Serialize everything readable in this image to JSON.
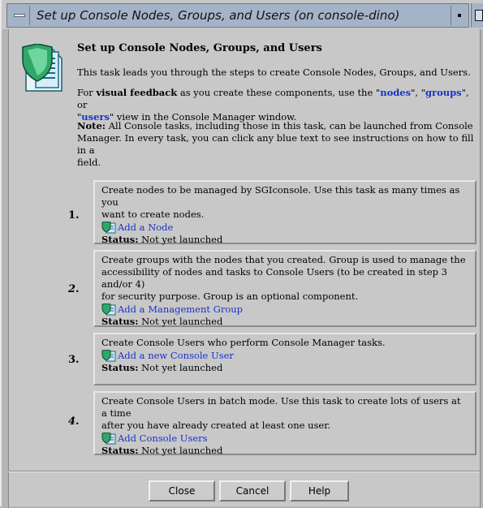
{
  "window": {
    "title": "Set up Console Nodes, Groups, and Users (on console-dino)"
  },
  "intro": {
    "heading": "Set up Console Nodes, Groups, and Users",
    "description": "This task leads you through the steps to create Console Nodes, Groups, and Users.",
    "feedback_prefix": "For ",
    "feedback_bold": "visual feedback",
    "feedback_mid": " as you create these components, use the \"",
    "link_nodes": "nodes",
    "sep1": "\", \"",
    "link_groups": "groups",
    "sep2": "\", or",
    "link_users": "users",
    "feedback_suffix": "\" view in the Console Manager window.",
    "note_bold": "Note:",
    "note_line1": " All Console tasks, including those in this task, can be launched from Console",
    "note_line2": "Manager.  In every task, you can click any blue text to see instructions on how to fill in a",
    "note_line3": "field."
  },
  "steps": [
    {
      "number": "1.",
      "line1": "Create nodes to be managed by SGIconsole.  Use this task as many times as you",
      "line2": "want to create nodes.",
      "line3": "",
      "link": "Add a Node",
      "status_label": "Status:",
      "status_value": " Not yet launched"
    },
    {
      "number": "2.",
      "line1": "Create groups with the nodes that you created.  Group is used to manage the",
      "line2": "accessibility of nodes and tasks to Console Users (to be created in step 3 and/or 4)",
      "line3": "for security purpose.  Group is an optional component.",
      "link": "Add a Management Group",
      "status_label": "Status:",
      "status_value": " Not yet launched"
    },
    {
      "number": "3.",
      "line1": "Create Console Users who perform Console Manager tasks.",
      "line2": "",
      "line3": "",
      "link": "Add a new Console User",
      "status_label": "Status:",
      "status_value": " Not yet launched"
    },
    {
      "number": "4.",
      "line1": "Create Console Users in batch mode. Use this task to create lots of users at a time",
      "line2": "after you have already created at least one user.",
      "line3": "",
      "link": "Add Console Users",
      "status_label": "Status:",
      "status_value": " Not yet launched"
    }
  ],
  "buttons": {
    "close": "Close",
    "cancel": "Cancel",
    "help": "Help"
  },
  "colors": {
    "titlebar": "#a5b3c8",
    "link": "#1633c8",
    "background": "#c8c8c8"
  },
  "icons": {
    "window_menu": "window-menu-icon",
    "minimize": "minimize-icon",
    "maximize": "maximize-icon",
    "hero": "shield-document-icon",
    "task": "task-icon"
  }
}
